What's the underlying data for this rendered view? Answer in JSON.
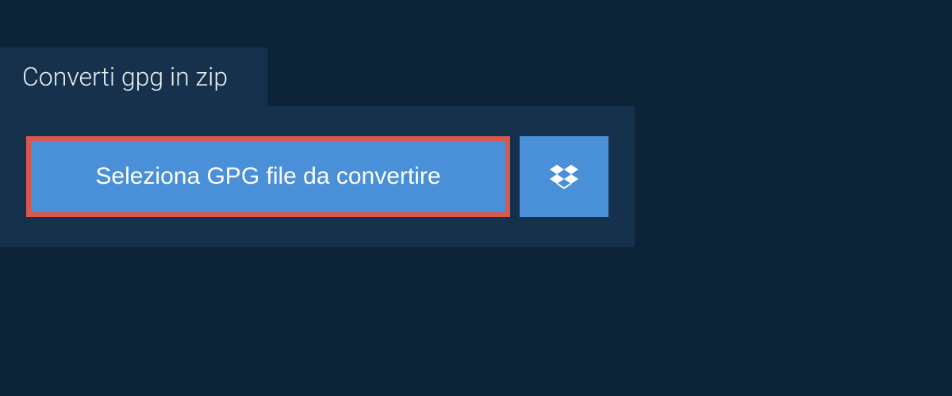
{
  "tab": {
    "title": "Converti gpg in zip"
  },
  "actions": {
    "select_file_label": "Seleziona GPG file da convertire"
  },
  "colors": {
    "background": "#0d2438",
    "panel": "#15314b",
    "button": "#4990d8",
    "highlight_border": "#d9584b",
    "text_light": "#e8eef4",
    "text_white": "#ffffff"
  }
}
